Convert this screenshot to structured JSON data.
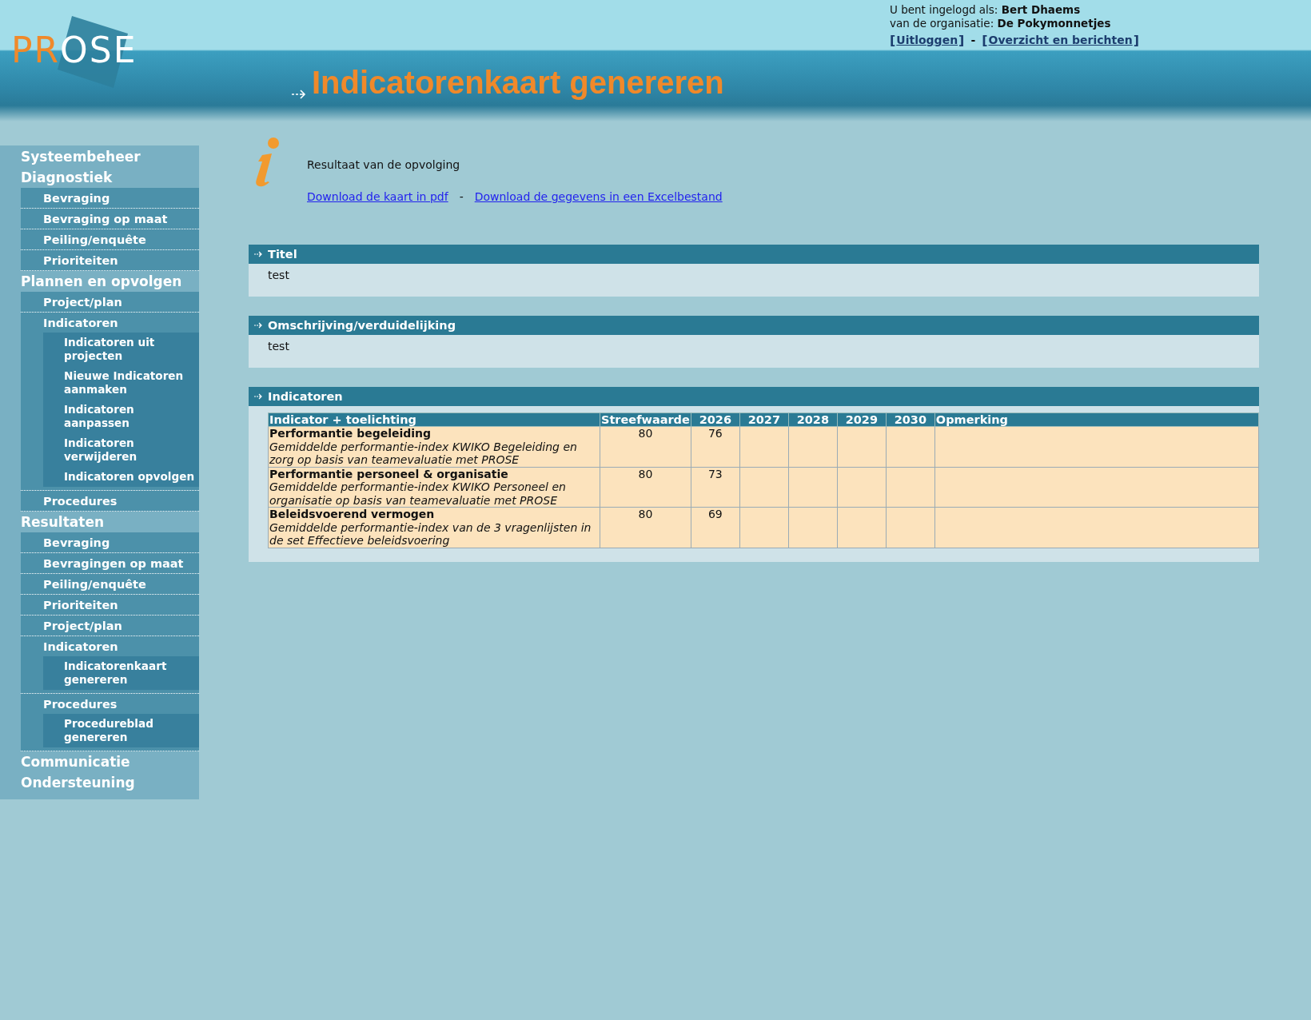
{
  "header": {
    "logo": {
      "parts": [
        "PR",
        "OSE"
      ]
    },
    "page_title": "Indicatorenkaart genereren",
    "user": {
      "logged_in_label": "U bent ingelogd als:",
      "user_name": "Bert Dhaems",
      "org_label": "van de organisatie:",
      "org_name": "De Pokymonnetjes",
      "links": [
        "Uitloggen",
        "Overzicht en berichten"
      ],
      "brackets": [
        "[",
        "]"
      ],
      "separator": "-"
    }
  },
  "sidebar": {
    "items": [
      {
        "label": "Systeembeheer"
      },
      {
        "label": "Diagnostiek",
        "children": [
          {
            "label": "Bevraging"
          },
          {
            "label": "Bevraging op maat"
          },
          {
            "label": "Peiling/enquête"
          },
          {
            "label": "Prioriteiten"
          }
        ]
      },
      {
        "label": "Plannen en opvolgen",
        "children": [
          {
            "label": "Project/plan"
          },
          {
            "label": "Indicatoren",
            "children": [
              {
                "label": "Indicatoren uit projecten"
              },
              {
                "label": "Nieuwe Indicatoren aanmaken"
              },
              {
                "label": "Indicatoren aanpassen"
              },
              {
                "label": "Indicatoren verwijderen"
              },
              {
                "label": "Indicatoren opvolgen"
              }
            ]
          },
          {
            "label": "Procedures"
          }
        ]
      },
      {
        "label": "Resultaten",
        "children": [
          {
            "label": "Bevraging"
          },
          {
            "label": "Bevragingen op maat"
          },
          {
            "label": "Peiling/enquête"
          },
          {
            "label": "Prioriteiten"
          },
          {
            "label": "Project/plan"
          },
          {
            "label": "Indicatoren",
            "children": [
              {
                "label": "Indicatorenkaart genereren"
              }
            ]
          },
          {
            "label": "Procedures",
            "children": [
              {
                "label": "Procedureblad genereren"
              }
            ]
          }
        ]
      },
      {
        "label": "Communicatie"
      },
      {
        "label": "Ondersteuning"
      }
    ]
  },
  "info": {
    "message": "Resultaat van de opvolging",
    "links": [
      "Download de kaart in pdf",
      "Download de gegevens in een Excelbestand"
    ],
    "separator": "-"
  },
  "sections": [
    {
      "kind": "text",
      "title": "Titel",
      "body": "test"
    },
    {
      "kind": "text",
      "title": "Omschrijving/verduidelijking",
      "body": "test"
    },
    {
      "kind": "table",
      "title": "Indicatoren",
      "table": {
        "columns": [
          "Indicator + toelichting",
          "Streefwaarde",
          "2026",
          "2027",
          "2028",
          "2029",
          "2030",
          "Opmerking"
        ],
        "rows": [
          {
            "name": "Performantie begeleiding",
            "description": "Gemiddelde performantie-index KWIKO Begeleiding en zorg op basis van teamevaluatie met PROSE",
            "values": [
              "80",
              "76"
            ]
          },
          {
            "name": "Performantie personeel & organisatie",
            "description": "Gemiddelde performantie-index KWIKO Personeel en organisatie op basis van teamevaluatie met PROSE",
            "values": [
              "80",
              "73"
            ]
          },
          {
            "name": "Beleidsvoerend vermogen",
            "description": "Gemiddelde performantie-index van de 3 vragenlijsten in de set Effectieve beleidsvoering",
            "values": [
              "80",
              "69"
            ]
          }
        ]
      }
    }
  ]
}
